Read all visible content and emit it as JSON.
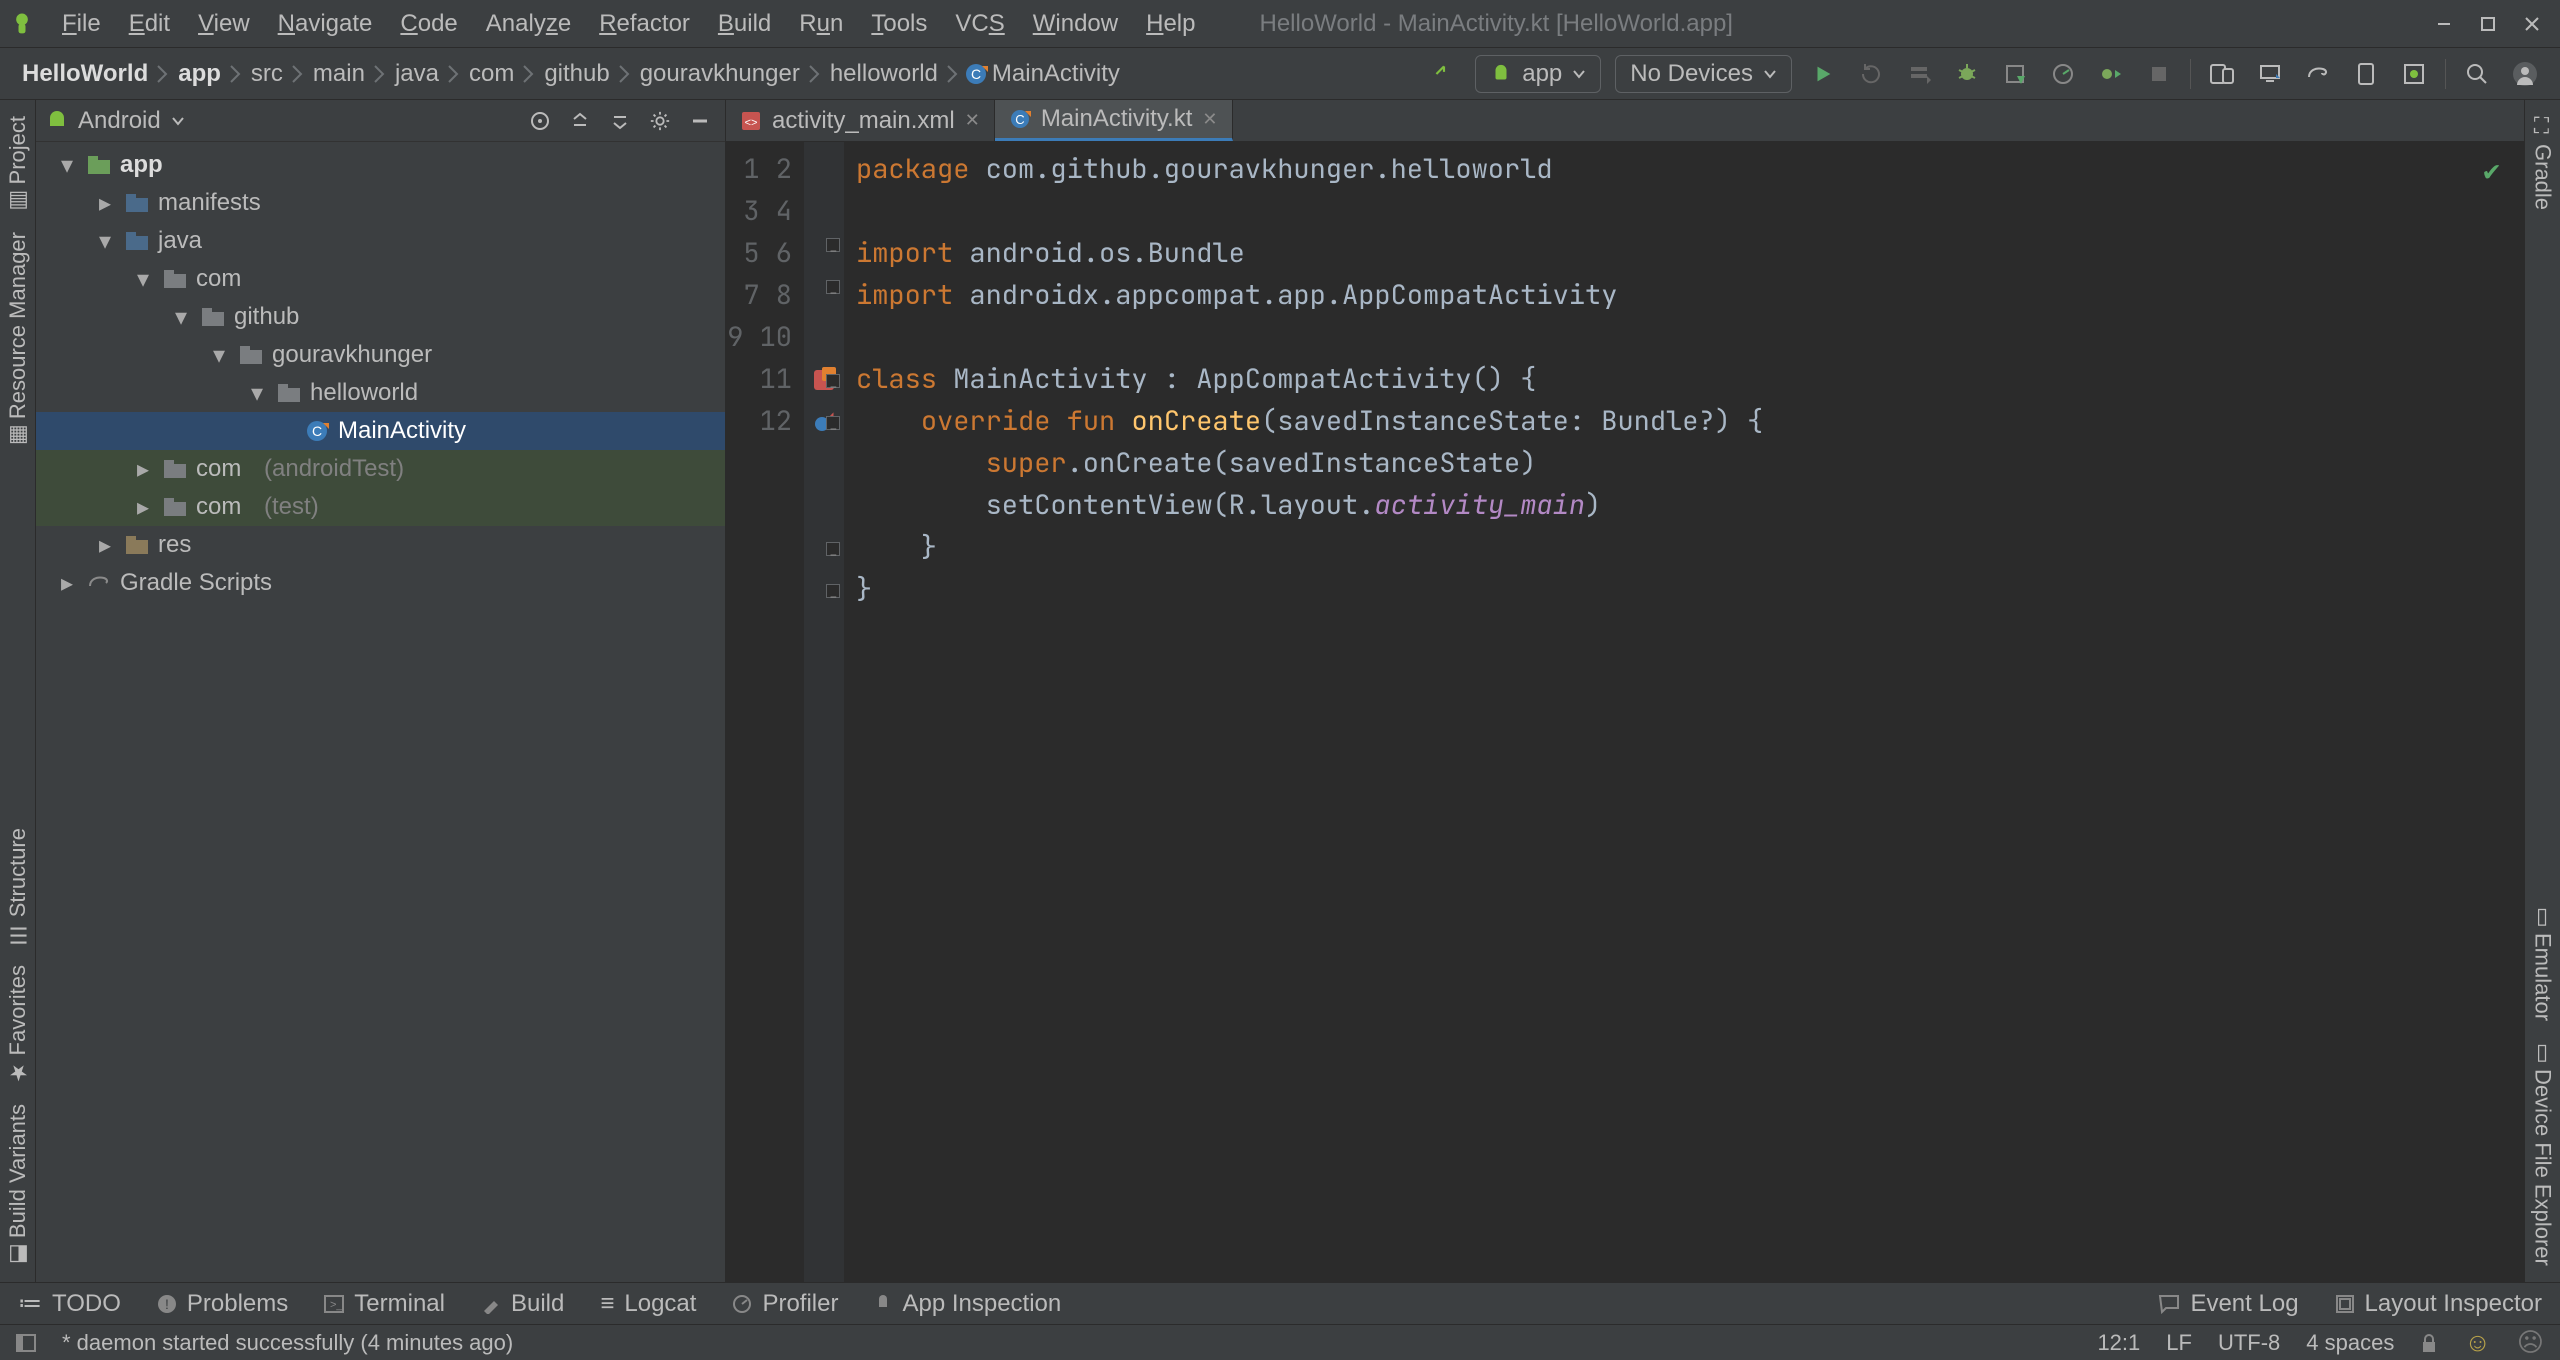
{
  "menu": {
    "items": [
      "File",
      "Edit",
      "View",
      "Navigate",
      "Code",
      "Analyze",
      "Refactor",
      "Build",
      "Run",
      "Tools",
      "VCS",
      "Window",
      "Help"
    ],
    "title": "HelloWorld - MainActivity.kt [HelloWorld.app]"
  },
  "breadcrumb": [
    "HelloWorld",
    "app",
    "src",
    "main",
    "java",
    "com",
    "github",
    "gouravkhunger",
    "helloworld",
    "MainActivity"
  ],
  "toolbar": {
    "run_config": "app",
    "devices": "No Devices"
  },
  "left_tool_tabs": [
    "Project",
    "Resource Manager",
    "Structure",
    "Favorites",
    "Build Variants"
  ],
  "right_tool_tabs": [
    "Gradle",
    "Emulator",
    "Device File Explorer"
  ],
  "project": {
    "header": "Android",
    "tree": {
      "app": "app",
      "manifests": "manifests",
      "java": "java",
      "com": "com",
      "github": "github",
      "gouravkhunger": "gouravkhunger",
      "helloworld": "helloworld",
      "MainActivity": "MainActivity",
      "com_androidTest": "com",
      "com_androidTest_suffix": "(androidTest)",
      "com_test": "com",
      "com_test_suffix": "(test)",
      "res": "res",
      "gradle_scripts": "Gradle Scripts"
    }
  },
  "editor": {
    "tabs": [
      {
        "label": "activity_main.xml",
        "icon": "xml-icon"
      },
      {
        "label": "MainActivity.kt",
        "icon": "kotlin-icon"
      }
    ],
    "active_tab": 1,
    "line_count": 12,
    "code": {
      "l1_kw": "package",
      "l1_rest": " com.github.gouravkhunger.helloworld",
      "l3_kw": "import",
      "l3_rest": " android.os.Bundle",
      "l4_kw": "import",
      "l4_rest": " androidx.appcompat.app.AppCompatActivity",
      "l6_kw": "class",
      "l6_rest": " MainActivity : AppCompatActivity() {",
      "l7_ind": "    ",
      "l7_kw1": "override",
      "l7_sp1": " ",
      "l7_kw2": "fun",
      "l7_sp2": " ",
      "l7_fn": "onCreate",
      "l7_rest": "(savedInstanceState: Bundle?) {",
      "l8_ind": "        ",
      "l8_kw": "super",
      "l8_rest": ".onCreate(savedInstanceState)",
      "l9_ind": "        ",
      "l9_a": "setContentView(R.layout.",
      "l9_it": "activity_main",
      "l9_b": ")",
      "l10": "    }",
      "l11": "}"
    }
  },
  "bottom": {
    "todo": "TODO",
    "problems": "Problems",
    "terminal": "Terminal",
    "build": "Build",
    "logcat": "Logcat",
    "profiler": "Profiler",
    "app_inspection": "App Inspection",
    "event_log": "Event Log",
    "layout_inspector": "Layout Inspector"
  },
  "status": {
    "message": "* daemon started successfully (4 minutes ago)",
    "cursor": "12:1",
    "line_sep": "LF",
    "encoding": "UTF-8",
    "indent": "4 spaces"
  }
}
